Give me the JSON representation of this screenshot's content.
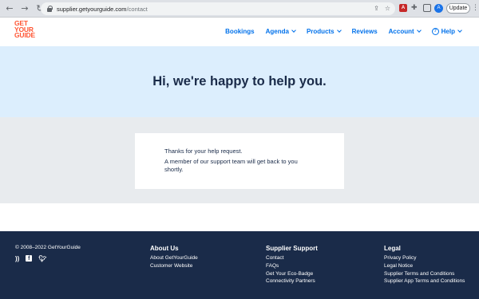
{
  "browser": {
    "url_domain": "supplier.getyourguide.com",
    "url_path": "/contact",
    "update_label": "Update",
    "profile_initial": "A",
    "pdf_ext_label": "A"
  },
  "header": {
    "logo_lines": [
      "GET",
      "YOUR",
      "GUIDE"
    ],
    "nav": {
      "bookings": "Bookings",
      "agenda": "Agenda",
      "products": "Products",
      "reviews": "Reviews",
      "account": "Account",
      "help": "Help"
    },
    "brand_color": "#ff5533",
    "link_color": "#0071eb"
  },
  "hero": {
    "title": "Hi, we're happy to help you."
  },
  "card": {
    "line1": "Thanks for your help request.",
    "line2": "A member of our support team will get back to you shortly."
  },
  "footer": {
    "copyright": "© 2008–2022 GetYourGuide",
    "about": {
      "heading": "About Us",
      "links": [
        "About GetYourGuide",
        "Customer Website"
      ]
    },
    "support": {
      "heading": "Supplier Support",
      "links": [
        "Contact",
        "FAQs",
        "Get Your Eco-Badge",
        "Connectivity Partners"
      ]
    },
    "legal": {
      "heading": "Legal",
      "links": [
        "Privacy Policy",
        "Legal Notice",
        "Supplier Terms and Conditions",
        "Supplier App Terms and Conditions"
      ]
    },
    "social_icons": [
      "rss-icon",
      "facebook-icon",
      "twitter-icon"
    ]
  }
}
